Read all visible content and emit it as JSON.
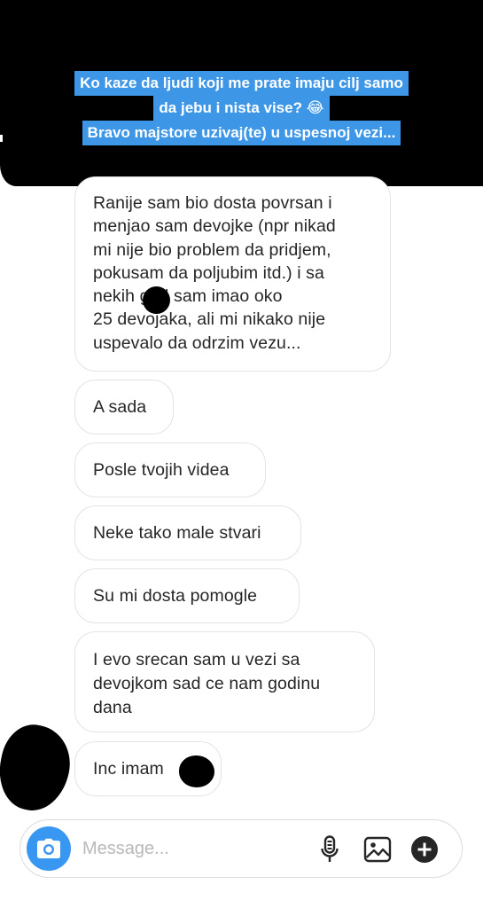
{
  "story_caption": {
    "line1": "Ko kaze da ljudi koji me prate imaju cilj samo",
    "line2": "da jebu i nista vise? 😂",
    "line3": "Bravo majstore uzivaj(te) u uspesnoj vezi..."
  },
  "messages": [
    {
      "text": "Ranije sam bio dosta povrsan i\nmenjao sam devojke (npr nikad\nmi nije bio problem da pridjem,\npokusam da poljubim itd.) i sa\nnekih       god sam imao oko\n25 devojaka, ali mi nikako nije\nuspevalo da odrzim vezu..."
    },
    {
      "text": "A sada"
    },
    {
      "text": "Posle tvojih videa"
    },
    {
      "text": "Neke tako male stvari"
    },
    {
      "text": "Su mi dosta pomogle"
    },
    {
      "text": "I evo srecan sam u vezi sa\ndevojkom sad ce nam godinu\ndana"
    },
    {
      "text": "Inc imam"
    }
  ],
  "composer": {
    "placeholder": "Message...",
    "value": ""
  },
  "colors": {
    "caption_highlight": "#3d96e6",
    "camera_button": "#3897f0",
    "bubble_border": "#e3e3e3",
    "text": "#262626"
  },
  "icons": {
    "camera": "camera-icon",
    "microphone": "microphone-icon",
    "gallery": "gallery-icon",
    "more": "plus-circle-icon"
  }
}
